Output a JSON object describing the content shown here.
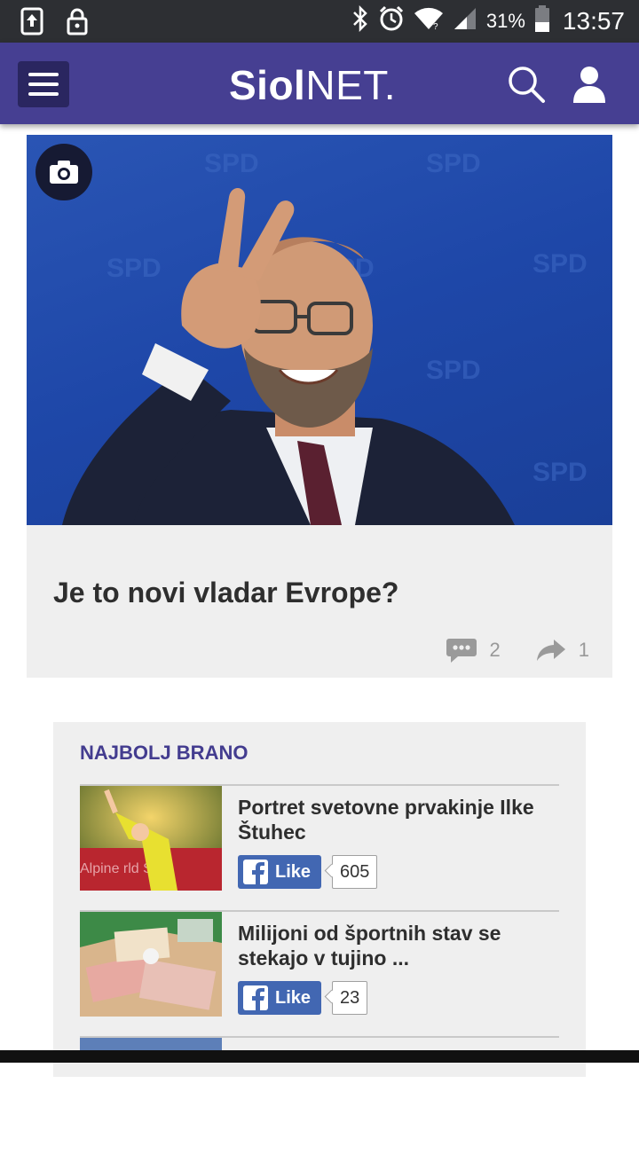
{
  "status_bar": {
    "battery_percent": "31%",
    "time": "13:57",
    "icons": [
      "upload-icon",
      "lock-icon",
      "bluetooth-icon",
      "alarm-icon",
      "wifi-icon",
      "signal-icon",
      "battery-icon"
    ]
  },
  "app_bar": {
    "logo_bold": "Siol",
    "logo_light": "NET.",
    "icons": [
      "menu-icon",
      "search-icon",
      "user-icon"
    ],
    "background": "#463f92"
  },
  "hero": {
    "title": "Je to novi vladar Evrope?",
    "comments": "2",
    "shares": "1",
    "media_icon": "camera-icon"
  },
  "most_read": {
    "heading": "NAJBOLJ BRANO",
    "items": [
      {
        "title": "Portret svetovne prvakinje Ilke Štuhec",
        "like_label": "Like",
        "like_count": "605"
      },
      {
        "title": "Milijoni od športnih stav se stekajo v tujino ...",
        "like_label": "Like",
        "like_count": "23"
      }
    ]
  }
}
